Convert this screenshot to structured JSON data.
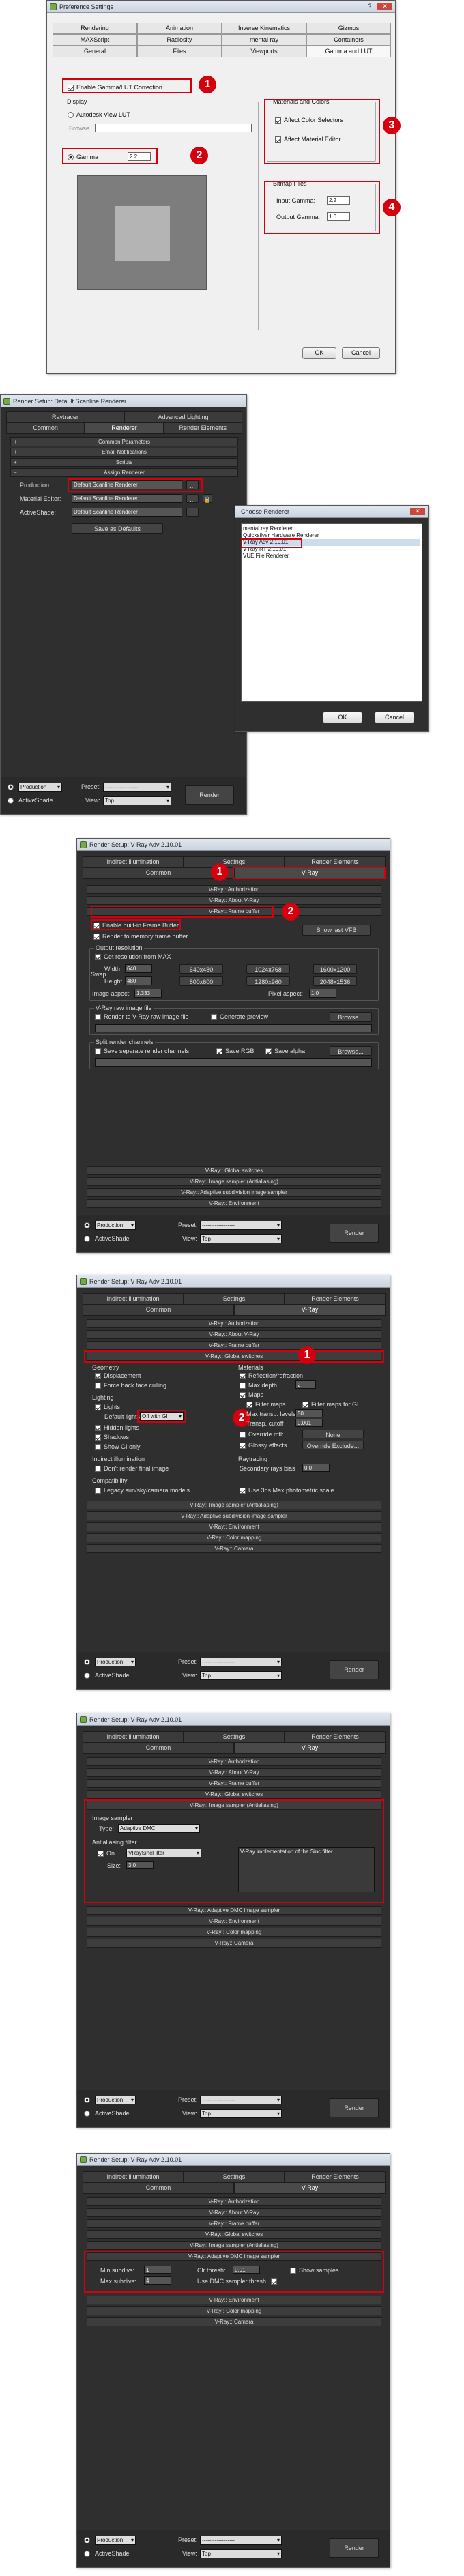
{
  "w1": {
    "title": "Preference Settings",
    "tabs1": [
      "Rendering",
      "Animation",
      "Inverse Kinematics",
      "Gizmos"
    ],
    "tabs2": [
      "MAXScript",
      "Radiosity",
      "mental ray",
      "Containers"
    ],
    "tabs3": [
      "General",
      "Files",
      "Viewports",
      "Gamma and LUT"
    ],
    "enable": "Enable Gamma/LUT Correction",
    "display": "Display",
    "autodesk": "Autodesk View LUT",
    "browse": "Browse...",
    "gamma": "Gamma",
    "gamma_val": "2.2",
    "matcol": "Materials and Colors",
    "affect_color": "Affect Color Selectors",
    "affect_mat": "Affect Material Editor",
    "bitmap": "Bitmap Files",
    "input": "Input Gamma:",
    "input_val": "2.2",
    "output": "Output Gamma:",
    "output_val": "1.0",
    "ok": "OK",
    "cancel": "Cancel"
  },
  "w2": {
    "title": "Render Setup: Default Scanline Renderer",
    "tabs1": [
      "Raytracer",
      "Advanced Lighting"
    ],
    "tabs2": [
      "Common",
      "Renderer",
      "Render Elements"
    ],
    "rolls": [
      "Common Parameters",
      "Email Notifications",
      "Scripts",
      "Assign Renderer"
    ],
    "prod": "Production:",
    "prod_val": "Default Scanline Renderer",
    "mat": "Material Editor:",
    "mat_val": "Default Scanline Renderer",
    "active": "ActiveShade:",
    "active_val": "Default Scanline Renderer",
    "save": "Save as Defaults",
    "foot_prod": "Production",
    "preset": "Preset:",
    "preset_val": "------------------",
    "view": "View:",
    "view_val": "Top",
    "render": "Render",
    "foot_active": "ActiveShade"
  },
  "choose": {
    "title": "Choose Renderer",
    "items": [
      "mental ray Renderer",
      "Quicksilver Hardware Renderer",
      "V-Ray Adv 2.10.01",
      "V-Ray RT 2.10.01",
      "VUE File Renderer"
    ],
    "ok": "OK",
    "cancel": "Cancel"
  },
  "w3": {
    "title": "Render Setup: V-Ray Adv 2.10.01",
    "tabs1": [
      "Indirect illumination",
      "Settings",
      "Render Elements"
    ],
    "tabs2": [
      "Common",
      "V-Ray"
    ],
    "rolls": [
      "V-Ray:: Authorization",
      "V-Ray:: About V-Ray",
      "V-Ray:: Frame buffer"
    ],
    "enable_fb": "Enable built-in Frame Buffer",
    "mem_fb": "Render to memory frame buffer",
    "show_vfb": "Show last VFB",
    "out_res": "Output resolution",
    "get_res": "Get resolution from MAX",
    "width": "Width",
    "width_val": "640",
    "height": "Height",
    "height_val": "480",
    "swap": "Swap",
    "res_btns": [
      "640x480",
      "1024x768",
      "1600x1200",
      "800x600",
      "1280x960",
      "2048x1536"
    ],
    "img_aspect": "Image aspect:",
    "img_aspect_val": "1.333",
    "px_aspect": "Pixel aspect:",
    "px_aspect_val": "1.0",
    "raw": "V-Ray raw image file",
    "raw_chk": "Render to V-Ray raw image file",
    "gen_prev": "Generate preview",
    "split": "Split render channels",
    "sep": "Save separate render channels",
    "save_rgb": "Save RGB",
    "save_alpha": "Save alpha",
    "browse": "Browse...",
    "rolls2": [
      "V-Ray:: Global switches",
      "V-Ray:: Image sampler (Antialiasing)",
      "V-Ray:: Adaptive subdivision image sampler",
      "V-Ray:: Environment"
    ]
  },
  "w4": {
    "rolls": [
      "V-Ray:: Authorization",
      "V-Ray:: About V-Ray",
      "V-Ray:: Frame buffer",
      "V-Ray:: Global switches"
    ],
    "geometry": "Geometry",
    "displacement": "Displacement",
    "backface": "Force back face culling",
    "lighting": "Lighting",
    "lights": "Lights",
    "default_lights": "Default lights",
    "dl_val": "Off with GI",
    "hidden": "Hidden lights",
    "shadows": "Shadows",
    "show_gi": "Show GI only",
    "materials": "Materials",
    "reflref": "Reflection/refraction",
    "maxdepth": "Max depth",
    "maxdepth_val": "2",
    "maps": "Maps",
    "filter": "Filter maps",
    "filter_gi": "Filter maps for GI",
    "maxtransp": "Max transp. levels",
    "maxtransp_val": "50",
    "transp": "Transp. cutoff",
    "transp_val": "0.001",
    "override": "Override mtl:",
    "none": "None",
    "glossy": "Glossy effects",
    "override_exc": "Override Exclude...",
    "indirect": "Indirect illumination",
    "dont": "Don't render final image",
    "raytracing": "Raytracing",
    "secondary": "Secondary rays bias",
    "secondary_val": "0.0",
    "compat": "Compatibility",
    "legacy": "Legacy sun/sky/camera models",
    "use3ds": "Use 3ds Max photometric scale",
    "rolls2": [
      "V-Ray:: Image sampler (Antialiasing)",
      "V-Ray:: Adaptive subdivision image sampler",
      "V-Ray:: Environment",
      "V-Ray:: Color mapping",
      "V-Ray:: Camera"
    ]
  },
  "w5": {
    "rolls": [
      "V-Ray:: Authorization",
      "V-Ray:: About V-Ray",
      "V-Ray:: Frame buffer",
      "V-Ray:: Global switches",
      "V-Ray:: Image sampler (Antialiasing)"
    ],
    "img_sampler": "Image sampler",
    "type": "Type:",
    "type_val": "Adaptive DMC",
    "aa": "Antialiasing filter",
    "on": "On",
    "filter_val": "VRaySincFilter",
    "desc": "V-Ray implementation of the Sinc filter.",
    "size": "Size:",
    "size_val": "3.0",
    "rolls2": [
      "V-Ray:: Adaptive DMC image sampler",
      "V-Ray:: Environment",
      "V-Ray:: Color mapping",
      "V-Ray:: Camera"
    ]
  },
  "w6": {
    "rolls": [
      "V-Ray:: Authorization",
      "V-Ray:: About V-Ray",
      "V-Ray:: Frame buffer",
      "V-Ray:: Global switches",
      "V-Ray:: Image sampler (Antialiasing)",
      "V-Ray:: Adaptive DMC image sampler"
    ],
    "min": "Min subdivs:",
    "min_val": "1",
    "max": "Max subdivs:",
    "max_val": "4",
    "clr": "Clr thresh:",
    "clr_val": "0.01",
    "use_dmc": "Use DMC sampler thresh.",
    "show_s": "Show samples",
    "rolls2": [
      "V-Ray:: Environment",
      "V-Ray:: Color mapping",
      "V-Ray:: Camera"
    ]
  },
  "badges": [
    "1",
    "2",
    "3",
    "4"
  ]
}
